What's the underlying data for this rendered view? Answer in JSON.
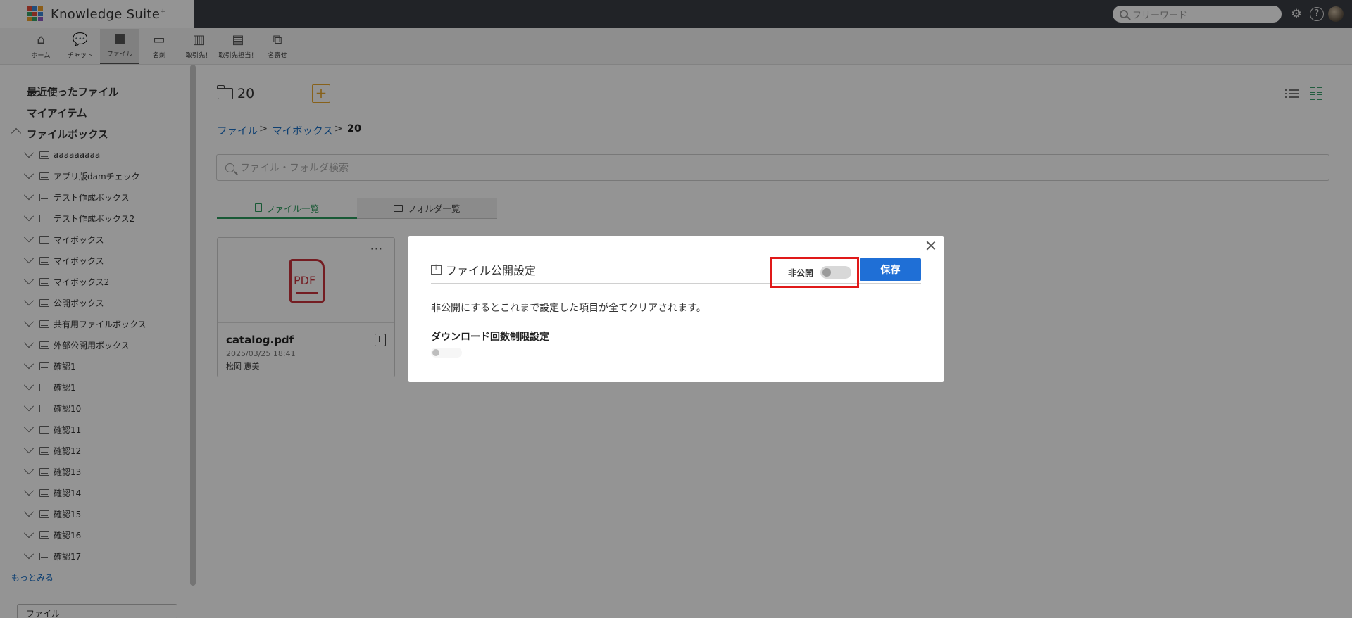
{
  "header": {
    "logo_text": "Knowledge Suite",
    "logo_sup": "+",
    "search_placeholder": "フリーワード",
    "help_glyph": "?"
  },
  "nav": {
    "items": [
      {
        "label": "ホーム",
        "icon": "home-icon"
      },
      {
        "label": "チャット",
        "icon": "chat-icon"
      },
      {
        "label": "ファイル",
        "icon": "folder-icon",
        "active": true
      },
      {
        "label": "名刺",
        "icon": "business-card-icon"
      },
      {
        "label": "取引先！",
        "icon": "building-icon"
      },
      {
        "label": "取引先担当！",
        "icon": "contact-person-icon"
      },
      {
        "label": "名寄せ",
        "icon": "merge-icon"
      }
    ]
  },
  "sidebar": {
    "recent": "最近使ったファイル",
    "my_items": "マイアイテム",
    "filebox": "ファイルボックス",
    "boxes": [
      "aaaaaaaaa",
      "アプリ版damチェック",
      "テスト作成ボックス",
      "テスト作成ボックス2",
      "マイボックス",
      "マイボックス",
      "マイボックス2",
      "公開ボックス",
      "共有用ファイルボックス",
      "外部公開用ボックス",
      "確認1",
      "確認1",
      "確認10",
      "確認11",
      "確認12",
      "確認13",
      "確認14",
      "確認15",
      "確認16",
      "確認17"
    ],
    "more": "もっとみる",
    "select_value": "ファイル"
  },
  "main": {
    "folder_name": "20",
    "add_label": "+",
    "breadcrumb": {
      "root": "ファイル",
      "sep": ">",
      "parent": "マイボックス",
      "current": "20"
    },
    "search_placeholder": "ファイル・フォルダ検索",
    "tabs": {
      "files": "ファイル一覧",
      "folders": "フォルダ一覧"
    },
    "file": {
      "name": "catalog.pdf",
      "date": "2025/03/25 18:41",
      "owner": "松岡 恵美",
      "menu": "···",
      "thumb_text": "PDF"
    }
  },
  "modal": {
    "title": "ファイル公開設定",
    "toggle_label": "非公開",
    "toggle_on": false,
    "save_label": "保存",
    "note": "非公開にするとこれまで設定した項目が全てクリアされます。",
    "download_limit_label": "ダウンロード回数制限設定"
  },
  "colors": {
    "header_bg": "#3a3d44",
    "accent_green": "#2a9a5c",
    "link_blue": "#1a6fc4",
    "save_blue": "#1f6fd6",
    "highlight_red": "#e01919",
    "add_orange": "#e8a82e",
    "pdf_red": "#c8323c"
  }
}
